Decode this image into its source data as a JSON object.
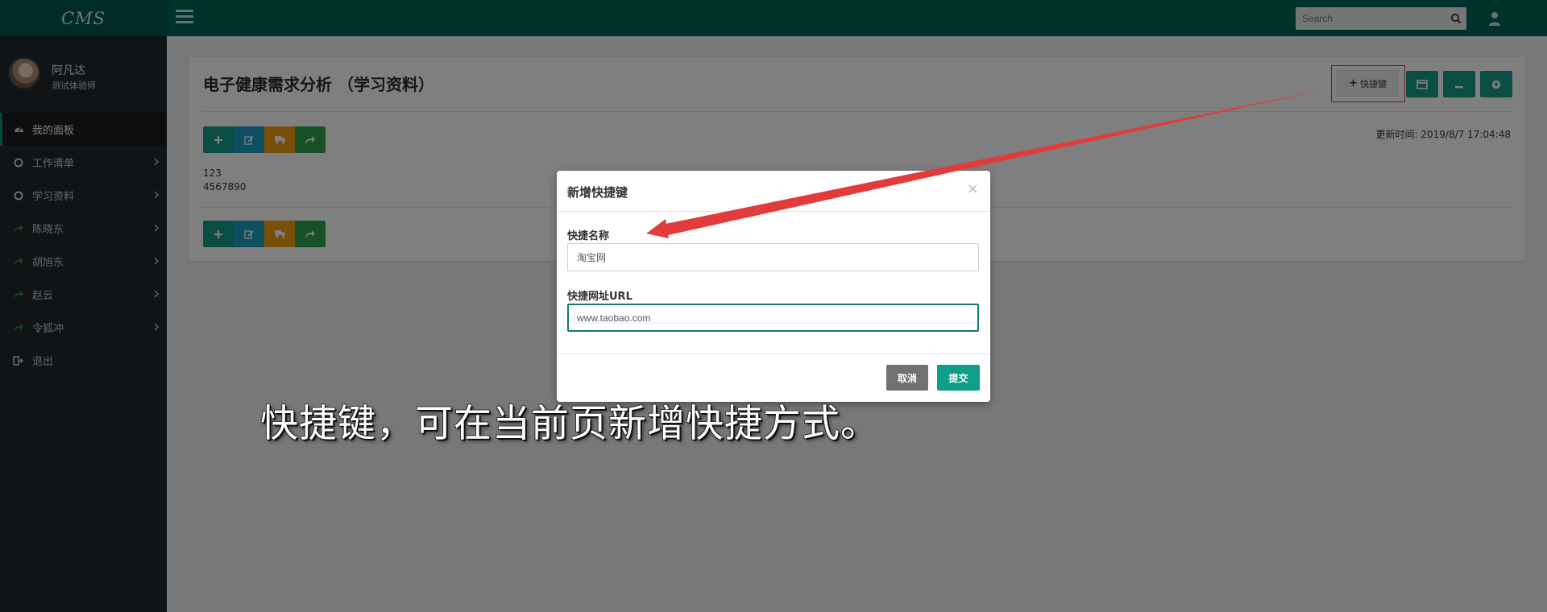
{
  "app": {
    "logo": "CMS",
    "search_placeholder": "Search"
  },
  "sidebar": {
    "profile": {
      "name": "阿凡达",
      "role": "测试体验师"
    },
    "items": [
      {
        "label": "我的面板",
        "icon": "dashboard-icon",
        "active": true,
        "chevron": false
      },
      {
        "label": "工作清单",
        "icon": "circle-icon",
        "active": false,
        "chevron": true
      },
      {
        "label": "学习资料",
        "icon": "circle-icon",
        "active": false,
        "chevron": true
      },
      {
        "label": "陈晓东",
        "icon": "share-icon",
        "active": false,
        "chevron": true
      },
      {
        "label": "胡旭东",
        "icon": "share-icon",
        "active": false,
        "chevron": true
      },
      {
        "label": "赵云",
        "icon": "share-icon",
        "active": false,
        "chevron": true
      },
      {
        "label": "令狐冲",
        "icon": "share-icon",
        "active": false,
        "chevron": true
      },
      {
        "label": "退出",
        "icon": "sign-out-icon",
        "active": false,
        "chevron": false
      }
    ]
  },
  "panel": {
    "title": "电子健康需求分析 （学习资料）",
    "quick_button_label": "快捷键",
    "update_time_label": "更新时间:",
    "update_time": "2019/8/7 17:04:48",
    "content_lines": [
      "123",
      "4567890"
    ]
  },
  "modal": {
    "title": "新增快捷键",
    "close": "×",
    "name_label": "快捷名称",
    "name_value": "淘宝网",
    "url_label": "快捷网址URL",
    "url_value": "www.taobao.com",
    "cancel_label": "取消",
    "submit_label": "提交"
  },
  "annotation": {
    "caption": "快捷键，可在当前页新增快捷方式。"
  },
  "colors": {
    "topbar": "#00645a",
    "sidebar": "#23292c",
    "teal": "#159a88",
    "blue": "#1b9ec0",
    "orange": "#f39c12",
    "green": "#2fa24f",
    "annotation_red": "#e23b3b"
  }
}
